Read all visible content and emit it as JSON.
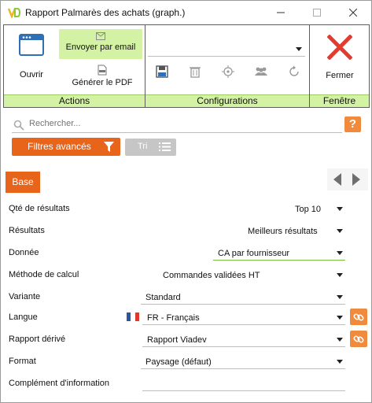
{
  "window": {
    "title": "Rapport Palmarès des achats (graph.)"
  },
  "ribbon": {
    "actions": {
      "label": "Actions",
      "open_label": "Ouvrir",
      "email_label": "Envoyer par email",
      "pdf_label": "Générer le PDF"
    },
    "configurations": {
      "label": "Configurations",
      "combo_value": "",
      "icons": [
        "save-icon",
        "trash-icon",
        "target-icon",
        "users-icon",
        "refresh-icon"
      ]
    },
    "window_group": {
      "label": "Fenêtre",
      "close_label": "Fermer"
    }
  },
  "search": {
    "placeholder": "Rechercher..."
  },
  "toolbar": {
    "filters_label": "Filtres avancés",
    "sort_label": "Tri"
  },
  "tabs": {
    "active": "Base"
  },
  "form": {
    "qte_label": "Qté de résultats",
    "qte_value": "Top 10",
    "resultats_label": "Résultats",
    "resultats_value": "Meilleurs résultats",
    "donnee_label": "Donnée",
    "donnee_value": "CA par fournisseur",
    "methode_label": "Méthode de calcul",
    "methode_value": "Commandes validées HT",
    "variante_label": "Variante",
    "variante_value": "Standard",
    "langue_label": "Langue",
    "langue_value": "FR - Français",
    "rapport_label": "Rapport dérivé",
    "rapport_value": "Rapport Viadev",
    "format_label": "Format",
    "format_value": "Paysage (défaut)",
    "complement_label": "Complément d'information",
    "complement_value": ""
  },
  "colors": {
    "accent_orange": "#e8641b",
    "ribbon_green": "#d4f2a3",
    "close_red": "#e03c31"
  }
}
